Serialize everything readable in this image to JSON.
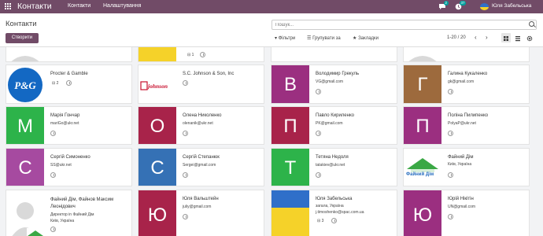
{
  "topbar": {
    "brand": "Контакти",
    "menu": [
      "Контакти",
      "Налаштування"
    ],
    "msg_badge": "2",
    "activity_badge": "37",
    "user": "Юля Забельська"
  },
  "control": {
    "title": "Контакти",
    "create": "Створити",
    "search_placeholder": "Пошук...",
    "filters": "Фільтри",
    "group_by": "Групувати за",
    "favorites": "Закладки",
    "pager": "1-20 / 20"
  },
  "cards": [
    {
      "name": "",
      "lines": [],
      "avatar": "person-silhouette",
      "letter": ""
    },
    {
      "name": "",
      "lines": [],
      "avatar": "yellow-image",
      "letter": "",
      "badge": "1"
    },
    {
      "name": "",
      "lines": [],
      "avatar": "blank",
      "letter": ""
    },
    {
      "name": "",
      "lines": [],
      "avatar": "person-silhouette",
      "letter": ""
    },
    {
      "name": "Procter & Gamble",
      "lines": [],
      "avatar": "pg-logo",
      "letter": "",
      "badge": "2"
    },
    {
      "name": "S.C. Johnson & Son, Inc",
      "lines": [],
      "avatar": "scjohnson-logo",
      "letter": ""
    },
    {
      "name": "Володимир Грекуль",
      "lines": [
        "VG@gmail.com"
      ],
      "avatar": "letter",
      "letter": "В",
      "color": "#9b2f80"
    },
    {
      "name": "Галина Кукаленко",
      "lines": [
        "gk@gmail.com"
      ],
      "avatar": "letter",
      "letter": "Г",
      "color": "#9d6a3d"
    },
    {
      "name": "Марія Гончар",
      "lines": [
        "mariGo@ukr.net"
      ],
      "avatar": "letter",
      "letter": "М",
      "color": "#2db34a"
    },
    {
      "name": "Олена Николенко",
      "lines": [
        "olenanik@ukr.net"
      ],
      "avatar": "letter",
      "letter": "О",
      "color": "#a8234a"
    },
    {
      "name": "Павло Кириленко",
      "lines": [
        "PK@gmail.com"
      ],
      "avatar": "letter",
      "letter": "П",
      "color": "#a8234a"
    },
    {
      "name": "Поліна Пилипенко",
      "lines": [
        "PolyaP@ukr.net"
      ],
      "avatar": "letter",
      "letter": "П",
      "color": "#9b2f80"
    },
    {
      "name": "Сергій Симоненко",
      "lines": [
        "SS@ukr.net"
      ],
      "avatar": "letter",
      "letter": "С",
      "color": "#a64aa0"
    },
    {
      "name": "Сергій Степанюк",
      "lines": [
        "Sergei@gmail.com"
      ],
      "avatar": "letter",
      "letter": "С",
      "color": "#3571b5"
    },
    {
      "name": "Тетяна Недоля",
      "lines": [
        "tatakiev@ukr.net"
      ],
      "avatar": "letter",
      "letter": "Т",
      "color": "#2db34a"
    },
    {
      "name": "Файний Дім",
      "lines": [
        "Київ, Україна"
      ],
      "avatar": "faynyi-logo",
      "letter": "",
      "logo_text": "Файний Дім"
    },
    {
      "name": "Файний Дім, Файнов Максим Леонідович",
      "lines": [
        "Директор in Файний Дім",
        "Київ, Україна"
      ],
      "avatar": "person-silhouette",
      "letter": ""
    },
    {
      "name": "Юля Вальштейн",
      "lines": [
        "juliy@gmail.com"
      ],
      "avatar": "letter",
      "letter": "Ю",
      "color": "#a8234a"
    },
    {
      "name": "Юля Забельська",
      "lines": [
        "загала, Україна",
        "j.timoshenko@spac.com.ua"
      ],
      "avatar": "flag",
      "letter": "",
      "badge": "3"
    },
    {
      "name": "Юрій Нікітін",
      "lines": [
        "UN@gmail.com"
      ],
      "avatar": "letter",
      "letter": "Ю",
      "color": "#9b2f80"
    }
  ],
  "colors": {
    "brand": "#714b67",
    "teal": "#00a09d"
  }
}
